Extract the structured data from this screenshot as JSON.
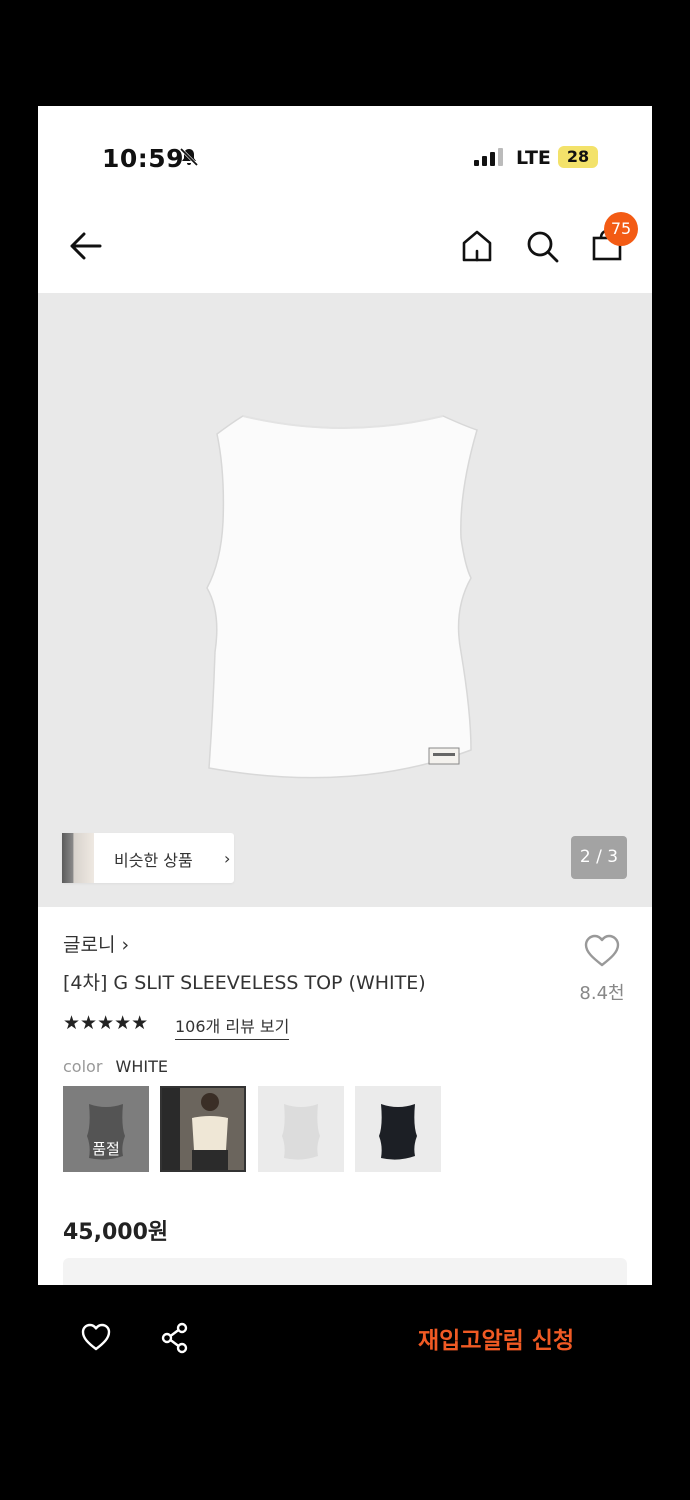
{
  "status_bar": {
    "time": "10:59",
    "network": "LTE",
    "battery": "28"
  },
  "nav": {
    "cart_count": "75"
  },
  "hero": {
    "similar_label": "비슷한 상품",
    "pager": "2 / 3"
  },
  "product": {
    "brand": "글로니",
    "title": "[4차] G SLIT SLEEVELESS TOP (WHITE)",
    "wish_count": "8.4천",
    "rating": 4.5,
    "stars_text": "★★★★★",
    "review_link": "106개 리뷰 보기",
    "color_label": "color",
    "color_value": "WHITE",
    "swatches": [
      {
        "name": "gray",
        "badge": "품절"
      },
      {
        "name": "cream-model"
      },
      {
        "name": "white"
      },
      {
        "name": "black"
      }
    ],
    "price": "45,000원"
  },
  "bottom_bar": {
    "cta": "재입고알림 신청"
  },
  "colors": {
    "accent": "#f05a24",
    "badge": "#f35b14",
    "battery": "#f3e26a"
  }
}
